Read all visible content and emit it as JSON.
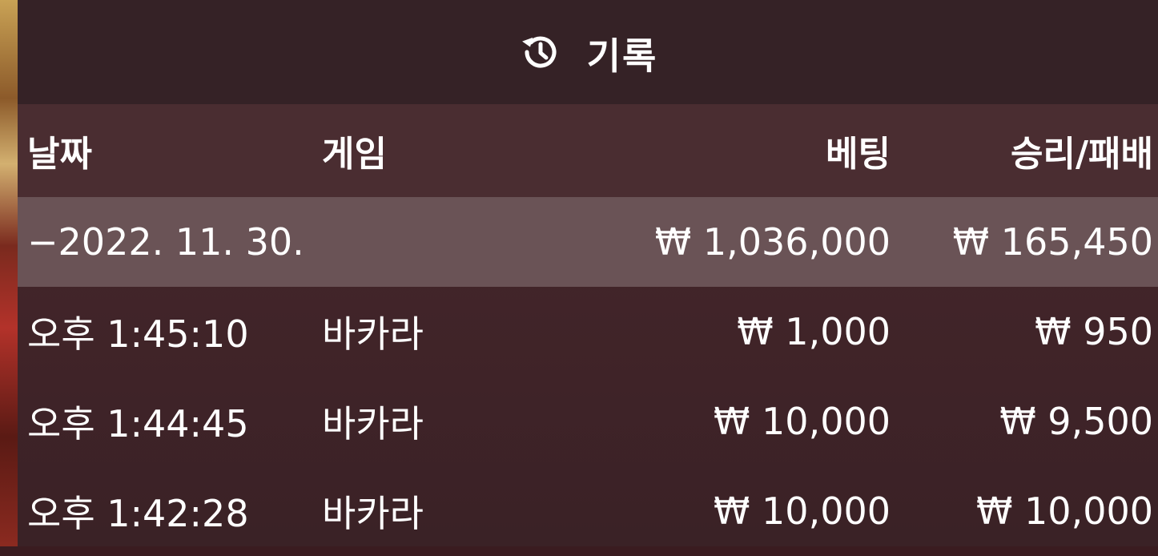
{
  "header": {
    "icon": "history-icon",
    "title": "기록"
  },
  "columns": {
    "date": "날짜",
    "game": "게임",
    "bet": "베팅",
    "win_loss": "승리/패배"
  },
  "group": {
    "date": "−2022. 11. 30.",
    "bet": "₩ 1,036,000",
    "win_loss": "₩ 165,450"
  },
  "rows": [
    {
      "time": "오후 1:45:10",
      "game": "바카라",
      "bet": "₩ 1,000",
      "win_loss": "₩ 950"
    },
    {
      "time": "오후 1:44:45",
      "game": "바카라",
      "bet": "₩ 10,000",
      "win_loss": "₩ 9,500"
    },
    {
      "time": "오후 1:42:28",
      "game": "바카라",
      "bet": "₩ 10,000",
      "win_loss": "₩ 10,000"
    }
  ]
}
